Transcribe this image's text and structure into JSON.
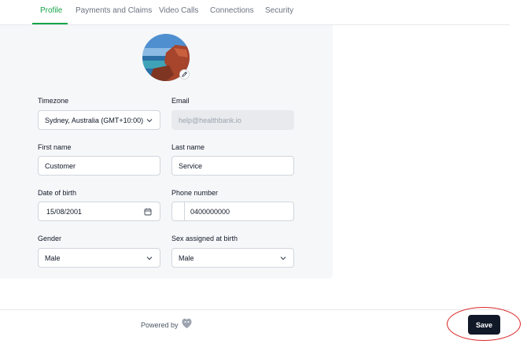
{
  "tabs": [
    {
      "label": "Profile",
      "active": true
    },
    {
      "label": "Payments and Claims",
      "active": false
    },
    {
      "label": "Video Calls",
      "active": false
    },
    {
      "label": "Connections",
      "active": false
    },
    {
      "label": "Security",
      "active": false
    }
  ],
  "form": {
    "timezone": {
      "label": "Timezone",
      "value": "Sydney, Australia (GMT+10:00)"
    },
    "email": {
      "label": "Email",
      "value": "help@healthbank.io"
    },
    "first_name": {
      "label": "First name",
      "value": "Customer"
    },
    "last_name": {
      "label": "Last name",
      "value": "Service"
    },
    "dob": {
      "label": "Date of birth",
      "value": "15/08/2001"
    },
    "phone": {
      "label": "Phone number",
      "value": "0400000000"
    },
    "gender": {
      "label": "Gender",
      "value": "Male"
    },
    "sex": {
      "label": "Sex assigned at birth",
      "value": "Male"
    }
  },
  "footer": {
    "powered_by": "Powered by",
    "save_label": "Save"
  },
  "colors": {
    "accent": "#16a34a",
    "primary_button": "#111827",
    "annotation": "#dc2626"
  },
  "icons": [
    "pencil-icon",
    "chevron-down-icon",
    "calendar-icon",
    "heart-logo-icon"
  ]
}
